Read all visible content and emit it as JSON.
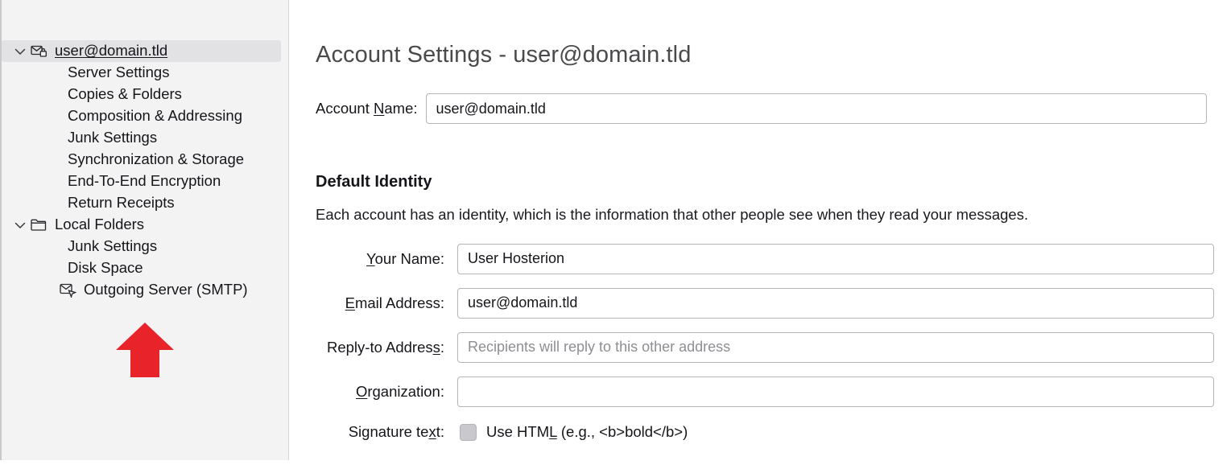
{
  "sidebar": {
    "items": [
      {
        "label": "user@domain.tld",
        "icon": "secure-mail-icon",
        "level": 0,
        "twisty": "chevron-down-icon",
        "selected": true,
        "underline": true
      },
      {
        "label": "Server Settings",
        "icon": "",
        "level": 1,
        "twisty": "",
        "selected": false,
        "underline": false
      },
      {
        "label": "Copies & Folders",
        "icon": "",
        "level": 1,
        "twisty": "",
        "selected": false,
        "underline": false
      },
      {
        "label": "Composition & Addressing",
        "icon": "",
        "level": 1,
        "twisty": "",
        "selected": false,
        "underline": false
      },
      {
        "label": "Junk Settings",
        "icon": "",
        "level": 1,
        "twisty": "",
        "selected": false,
        "underline": false
      },
      {
        "label": "Synchronization & Storage",
        "icon": "",
        "level": 1,
        "twisty": "",
        "selected": false,
        "underline": false
      },
      {
        "label": "End-To-End Encryption",
        "icon": "",
        "level": 1,
        "twisty": "",
        "selected": false,
        "underline": false
      },
      {
        "label": "Return Receipts",
        "icon": "",
        "level": 1,
        "twisty": "",
        "selected": false,
        "underline": false
      },
      {
        "label": "Local Folders",
        "icon": "folder-icon",
        "level": 0,
        "twisty": "chevron-down-icon",
        "selected": false,
        "underline": false
      },
      {
        "label": "Junk Settings",
        "icon": "",
        "level": 1,
        "twisty": "",
        "selected": false,
        "underline": false
      },
      {
        "label": "Disk Space",
        "icon": "",
        "level": 1,
        "twisty": "",
        "selected": false,
        "underline": false
      },
      {
        "label": "Outgoing Server (SMTP)",
        "icon": "outgoing-server-icon",
        "level": 0,
        "twisty": "",
        "selected": false,
        "underline": false
      }
    ]
  },
  "annotation": {
    "arrow": "red-up-arrow",
    "color": "#e8232a"
  },
  "main": {
    "title": "Account Settings - user@domain.tld",
    "account_name": {
      "label_pre": "Account ",
      "label_accel": "N",
      "label_post": "ame:",
      "value": "user@domain.tld"
    },
    "section": {
      "heading": "Default Identity",
      "description": "Each account has an identity, which is the information that other people see when they read your messages."
    },
    "fields": [
      {
        "label_pre": "",
        "label_accel": "Y",
        "label_post": "our Name:",
        "value": "User Hosterion",
        "placeholder": ""
      },
      {
        "label_pre": "",
        "label_accel": "E",
        "label_post": "mail Address:",
        "value": "user@domain.tld",
        "placeholder": ""
      },
      {
        "label_pre": "Reply-to Addres",
        "label_accel": "s",
        "label_post": ":",
        "value": "",
        "placeholder": "Recipients will reply to this other address"
      },
      {
        "label_pre": "",
        "label_accel": "O",
        "label_post": "rganization:",
        "value": "",
        "placeholder": ""
      }
    ],
    "signature": {
      "label_pre": "Signature te",
      "label_accel": "x",
      "label_post": "t:",
      "checkbox_checked": false,
      "checkbox_text_pre": "Use HTM",
      "checkbox_text_accel": "L",
      "checkbox_text_post": " (e.g., <b>bold</b>)"
    }
  }
}
